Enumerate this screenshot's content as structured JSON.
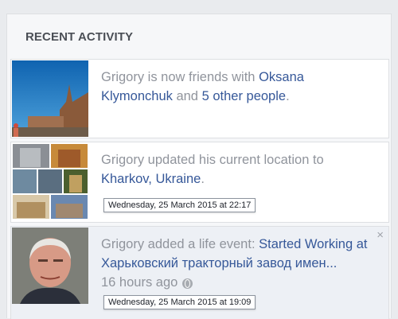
{
  "panel": {
    "title": "RECENT ACTIVITY"
  },
  "items": [
    {
      "actor": "Grigory",
      "pre": " is now friends with ",
      "link1": "Oksana Klymonchuk",
      "mid": " and ",
      "link2": "5 other people",
      "post": "."
    },
    {
      "actor": "Grigory",
      "pre": " updated his current location to ",
      "link1": "Kharkov, Ukraine",
      "post": ".",
      "tooltip": "Wednesday, 25 March 2015 at 22:17"
    },
    {
      "actor": "Grigory",
      "pre": " added a life event: ",
      "link1": "Started Working at Харьковский тракторный завод имен...",
      "time": "16 hours ago",
      "close": "×",
      "tooltip": "Wednesday, 25 March 2015 at 19:09"
    }
  ],
  "colors": {
    "link": "#365899",
    "muted": "#90949c",
    "highlight_bg": "#edf0f5"
  },
  "icons": {
    "privacy": "globe-icon",
    "remove": "close-icon"
  }
}
